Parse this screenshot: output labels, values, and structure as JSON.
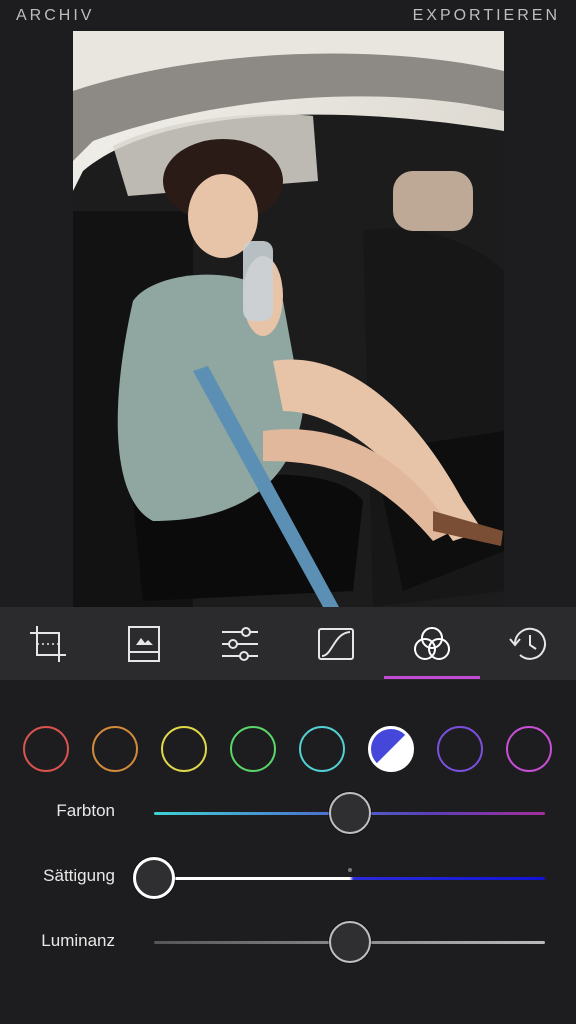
{
  "header": {
    "left_label": "ARCHIV",
    "right_label": "EXPORTIEREN"
  },
  "photo": {
    "subject": "photo",
    "colors": {
      "car_interior": "#1f1f1f",
      "window_light": "#e8e4dc",
      "dress": "#8fa7a0",
      "skin": "#e7c3a8",
      "seatbelt": "#5b8fb4",
      "hair": "#2a1b17"
    }
  },
  "toolbar": {
    "active_index": 4,
    "accent": "#c34bd8",
    "tools": [
      {
        "name": "crop",
        "icon": "crop-icon"
      },
      {
        "name": "image",
        "icon": "image-icon"
      },
      {
        "name": "adjust",
        "icon": "sliders-icon"
      },
      {
        "name": "curves",
        "icon": "curves-icon"
      },
      {
        "name": "color",
        "icon": "color-circles-icon"
      },
      {
        "name": "history",
        "icon": "history-icon"
      }
    ]
  },
  "swatches": [
    {
      "name": "red",
      "color": "#d9534f"
    },
    {
      "name": "orange",
      "color": "#d38a3b"
    },
    {
      "name": "yellow",
      "color": "#dfd94a"
    },
    {
      "name": "green",
      "color": "#5ad66a"
    },
    {
      "name": "cyan",
      "color": "#52d0d2"
    },
    {
      "name": "blue",
      "color": "#4447d9",
      "selected": true
    },
    {
      "name": "violet",
      "color": "#7a4fdc"
    },
    {
      "name": "magenta",
      "color": "#c84fd6"
    }
  ],
  "sliders": [
    {
      "label": "Farbton",
      "value": 0.5,
      "track": "linear-gradient(90deg,#3ed3d3,#4c6fd0 45%,#5a3fb7 70%,#a22f9c)"
    },
    {
      "label": "Sättigung",
      "value": 0.0,
      "track": "linear-gradient(90deg,#ffffff 0%,#ffffff 50%,#2b2bd8 51%,#1212d6 100%)"
    },
    {
      "label": "Luminanz",
      "value": 0.5,
      "track": "linear-gradient(90deg,#555555,#bbbbbb)"
    }
  ]
}
